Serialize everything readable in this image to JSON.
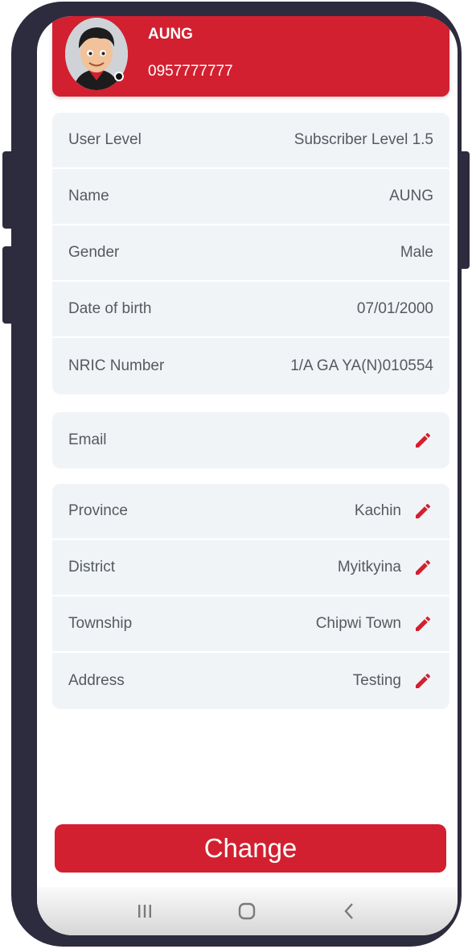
{
  "header": {
    "name": "AUNG",
    "phone": "0957777777"
  },
  "profile": [
    {
      "label": "User Level",
      "value": "Subscriber Level 1.5"
    },
    {
      "label": "Name",
      "value": "AUNG"
    },
    {
      "label": "Gender",
      "value": "Male"
    },
    {
      "label": "Date of birth",
      "value": "07/01/2000"
    },
    {
      "label": "NRIC Number",
      "value": "1/A GA YA(N)010554"
    }
  ],
  "contact": [
    {
      "label": "Email",
      "value": ""
    }
  ],
  "location": [
    {
      "label": "Province",
      "value": "Kachin"
    },
    {
      "label": "District",
      "value": "Myitkyina"
    },
    {
      "label": "Township",
      "value": "Chipwi Town"
    },
    {
      "label": "Address",
      "value": "Testing"
    }
  ],
  "change_label": "Change",
  "icons": {
    "edit": "pencil-icon",
    "nav_recent": "recent-apps-icon",
    "nav_home": "home-icon",
    "nav_back": "back-icon"
  },
  "colors": {
    "accent": "#d22030",
    "card_bg": "#f1f4f7",
    "frame": "#2d2c3e"
  }
}
